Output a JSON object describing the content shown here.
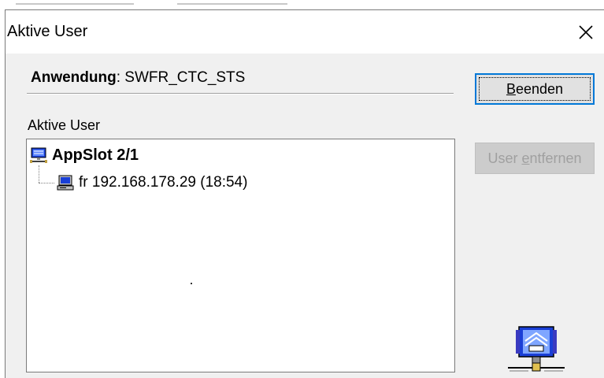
{
  "window": {
    "title": "Aktive User"
  },
  "application": {
    "label": "Anwendung",
    "separator": ":",
    "value": "SWFR_CTC_STS"
  },
  "user_list": {
    "label": "Aktive User",
    "root": {
      "label": "AppSlot 2/1",
      "icon": "server-icon"
    },
    "children": [
      {
        "label": "fr 192.168.178.29  (18:54)",
        "icon": "computer-icon"
      }
    ]
  },
  "buttons": {
    "close_first": "B",
    "close_rest": "eenden",
    "remove_prefix": "User ",
    "remove_underlined": "e",
    "remove_suffix": "ntfernen"
  },
  "colors": {
    "focus_blue": "#0078d7",
    "icon_blue": "#1a3fd6",
    "dialog_bg": "#f0f0f0"
  }
}
